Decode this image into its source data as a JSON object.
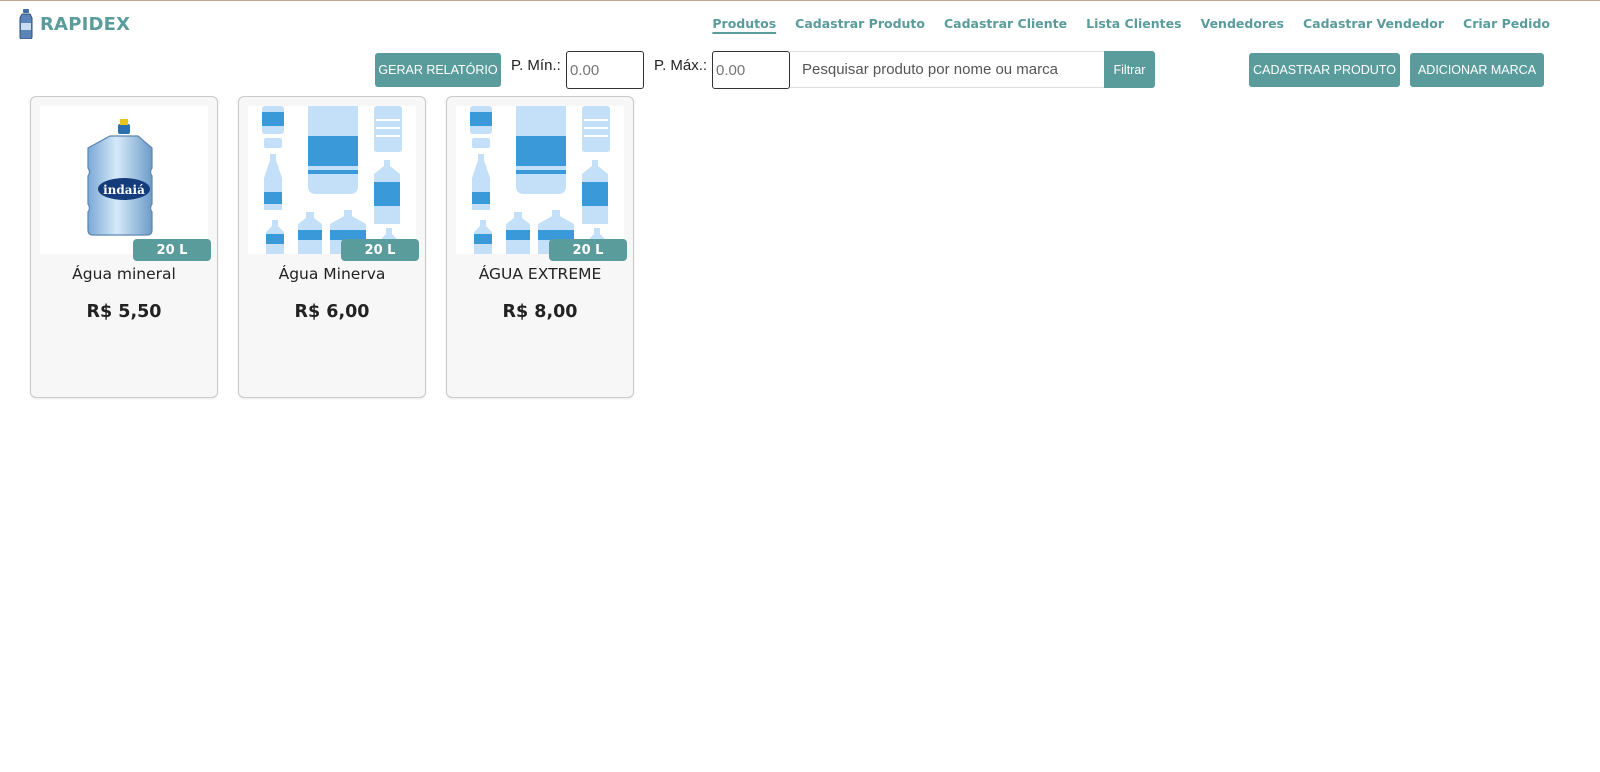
{
  "app": {
    "title": "RAPIDEX"
  },
  "nav": [
    {
      "label": "Produtos",
      "active": true
    },
    {
      "label": "Cadastrar Produto"
    },
    {
      "label": "Cadastrar Cliente"
    },
    {
      "label": "Lista Clientes"
    },
    {
      "label": "Vendedores"
    },
    {
      "label": "Cadastrar Vendedor"
    },
    {
      "label": "Criar Pedido"
    }
  ],
  "toolbar": {
    "report_button": "GERAR RELATÓRIO",
    "min_label": "P. Mín.:",
    "min_placeholder": "0.00",
    "max_label": "P. Máx.:",
    "max_placeholder": "0.00",
    "search_placeholder": "Pesquisar produto por nome ou marca",
    "filter_button": "Filtrar",
    "add_product_button": "CADASTRAR PRODUTO",
    "add_brand_button": "ADICIONAR MARCA"
  },
  "products": [
    {
      "name": "Água mineral",
      "volume": "20 L",
      "price": "R$ 5,50",
      "image": "indaia-galao",
      "brand_on_image": "indaiá"
    },
    {
      "name": "Água Minerva",
      "volume": "20 L",
      "price": "R$ 6,00",
      "image": "bottles-pattern"
    },
    {
      "name": "ÁGUA EXTREME",
      "volume": "20 L",
      "price": "R$ 8,00",
      "image": "bottles-pattern"
    }
  ],
  "colors": {
    "accent": "#5a9c9c",
    "bottle_dark": "#3a9ad9",
    "bottle_light": "#c4e0f8"
  }
}
